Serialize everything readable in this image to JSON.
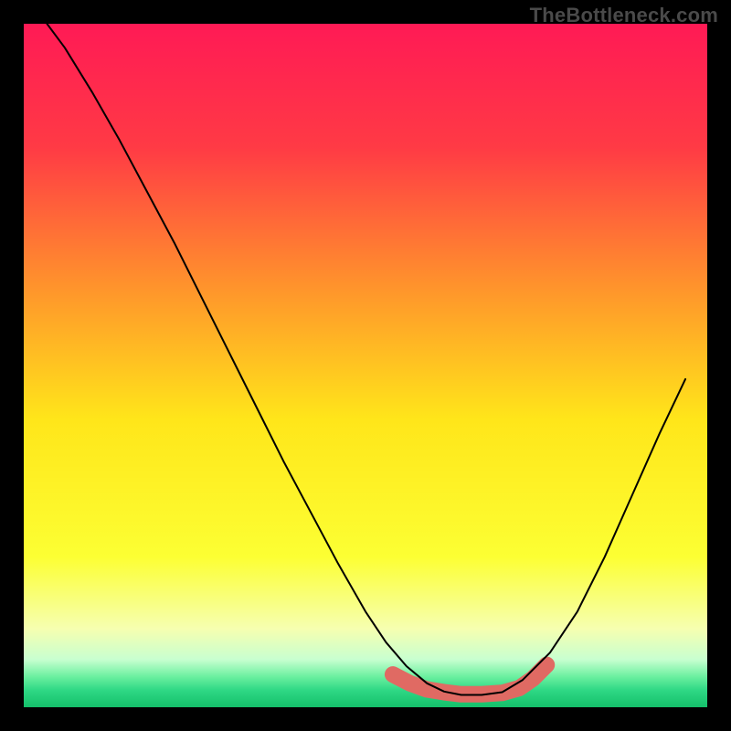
{
  "watermark": "TheBottleneck.com",
  "chart_data": {
    "type": "line",
    "title": "",
    "xlabel": "",
    "ylabel": "",
    "xlim": [
      0,
      100
    ],
    "ylim": [
      0,
      100
    ],
    "grid": false,
    "legend": false,
    "background_gradient_stops": [
      {
        "pos": 0.0,
        "color": "#ff1a55"
      },
      {
        "pos": 0.18,
        "color": "#ff3a45"
      },
      {
        "pos": 0.4,
        "color": "#ff9a2a"
      },
      {
        "pos": 0.58,
        "color": "#ffe61a"
      },
      {
        "pos": 0.78,
        "color": "#fcff33"
      },
      {
        "pos": 0.885,
        "color": "#f6ffb0"
      },
      {
        "pos": 0.93,
        "color": "#c8ffd0"
      },
      {
        "pos": 0.955,
        "color": "#6cf0a0"
      },
      {
        "pos": 0.975,
        "color": "#2fd885"
      },
      {
        "pos": 1.0,
        "color": "#14c06a"
      }
    ],
    "series": [
      {
        "name": "bottleneck-curve",
        "color": "#000000",
        "stroke_width": 2,
        "x": [
          3.4,
          6,
          10,
          14,
          18,
          22,
          26,
          30,
          34,
          38,
          42,
          46,
          50,
          53,
          56,
          59,
          61.5,
          64,
          67,
          70,
          73,
          77,
          81,
          85,
          89,
          93,
          96.8
        ],
        "y": [
          100,
          96.5,
          90,
          83,
          75.5,
          68,
          60,
          52,
          44,
          36,
          28.5,
          21,
          14,
          9.5,
          6,
          3.5,
          2.3,
          1.8,
          1.8,
          2.2,
          4,
          8,
          14,
          22,
          31,
          40,
          48
        ]
      },
      {
        "name": "optimal-band-marker",
        "color": "#e06a63",
        "stroke_width": 18,
        "linecap": "round",
        "x": [
          54,
          56.5,
          59,
          61.5,
          64,
          67,
          70,
          72.5,
          74.5,
          76.5
        ],
        "y": [
          4.8,
          3.5,
          2.6,
          2.2,
          1.9,
          1.9,
          2.1,
          2.8,
          4.2,
          6.2
        ]
      }
    ]
  }
}
